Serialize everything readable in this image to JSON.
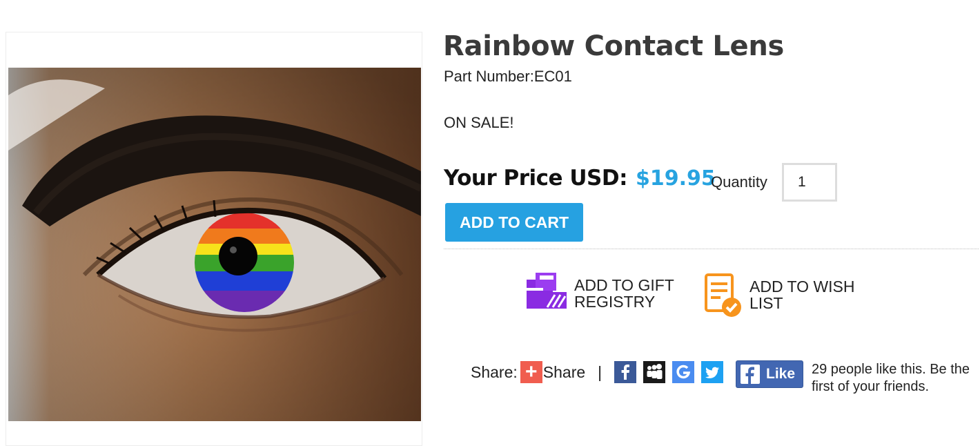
{
  "product": {
    "title": "Rainbow Contact Lens",
    "part_number": "Part Number:EC01",
    "sale_text": "ON SALE!",
    "price_label": "Your Price USD:",
    "price": "$19.95",
    "quantity_label": "Quantity",
    "quantity_value": "1",
    "add_to_cart": "ADD TO CART"
  },
  "actions": {
    "gift_line1": "ADD TO GIFT",
    "gift_line2": "REGISTRY",
    "wish_line1": "ADD TO WISH",
    "wish_line2": "LIST"
  },
  "share": {
    "label": "Share:",
    "button_text": "Share",
    "separator": "|",
    "icons": [
      "facebook-icon",
      "myspace-icon",
      "google-icon",
      "twitter-icon"
    ]
  },
  "like": {
    "button": "Like",
    "count_text": "29 people like this. Be the first of your friends."
  },
  "colors": {
    "accent": "#26a1e1",
    "price": "#27a3e0",
    "facebook": "#3b5998",
    "google": "#4a8cf0",
    "twitter": "#1da1f2",
    "share_plus": "#f05d4f",
    "gift_icon": "#8a2be2",
    "wish_icon": "#f7941d"
  }
}
